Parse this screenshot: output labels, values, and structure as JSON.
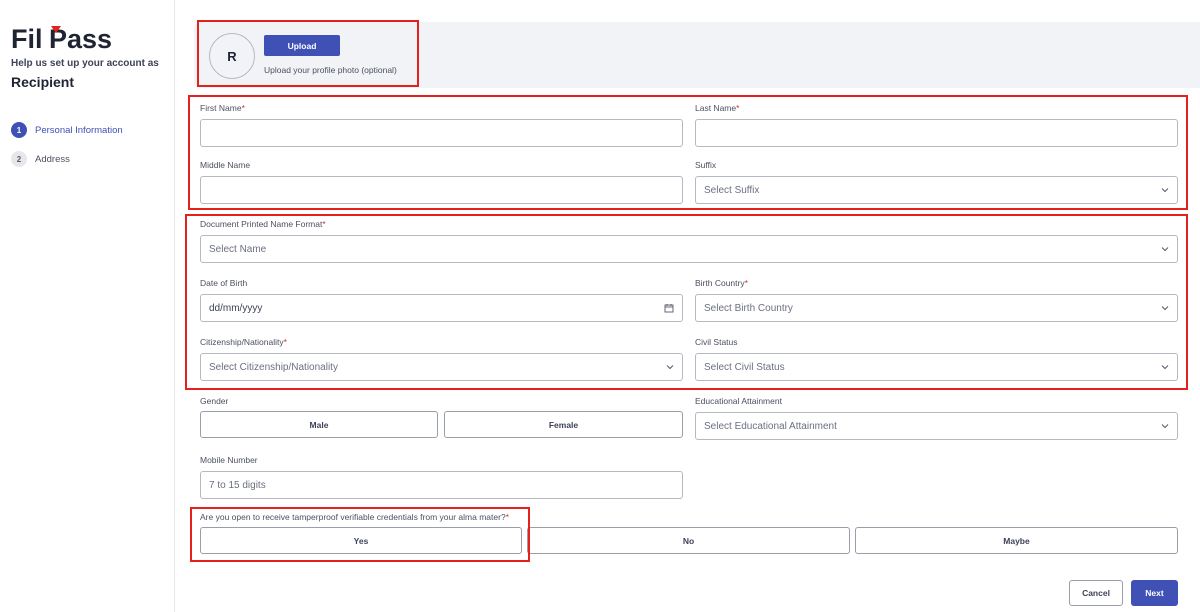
{
  "brand": {
    "logo_text": "FilPass",
    "accent": "#3f51b5",
    "logo_mark_color": "#e3211d"
  },
  "sidebar": {
    "setup_text": "Help us set up your account as",
    "role": "Recipient",
    "steps": [
      {
        "number": "1",
        "label": "Personal Information",
        "active": true
      },
      {
        "number": "2",
        "label": "Address",
        "active": false
      }
    ]
  },
  "profile": {
    "avatar_initial": "R",
    "upload_label": "Upload",
    "upload_hint": "Upload your profile photo (optional)"
  },
  "form": {
    "first_name": {
      "label": "First Name",
      "required": "*",
      "value": ""
    },
    "last_name": {
      "label": "Last Name",
      "required": "*",
      "value": ""
    },
    "middle_name": {
      "label": "Middle Name",
      "value": ""
    },
    "suffix": {
      "label": "Suffix",
      "placeholder": "Select Suffix"
    },
    "name_format": {
      "label": "Document Printed Name Format",
      "required": "*",
      "placeholder": "Select Name"
    },
    "date_of_birth": {
      "label": "Date of Birth",
      "placeholder": "dd/mm/yyyy"
    },
    "birth_country": {
      "label": "Birth Country",
      "required": "*",
      "placeholder": "Select Birth Country"
    },
    "citizenship": {
      "label": "Citizenship/Nationality",
      "required": "*",
      "placeholder": "Select Citizenship/Nationality"
    },
    "civil_status": {
      "label": "Civil Status",
      "placeholder": "Select Civil Status"
    },
    "gender": {
      "label": "Gender",
      "options": [
        "Male",
        "Female"
      ]
    },
    "education": {
      "label": "Educational Attainment",
      "placeholder": "Select Educational Attainment"
    },
    "mobile": {
      "label": "Mobile Number",
      "placeholder": "7 to 15 digits"
    },
    "credentials": {
      "label": "Are you open to receive tamperproof verifiable credentials from your alma mater?",
      "required": "*",
      "options": [
        "Yes",
        "No",
        "Maybe"
      ]
    }
  },
  "actions": {
    "cancel_label": "Cancel",
    "next_label": "Next"
  },
  "icons": {
    "calendar": "calendar-icon",
    "chevron": "chevron-down-icon"
  }
}
